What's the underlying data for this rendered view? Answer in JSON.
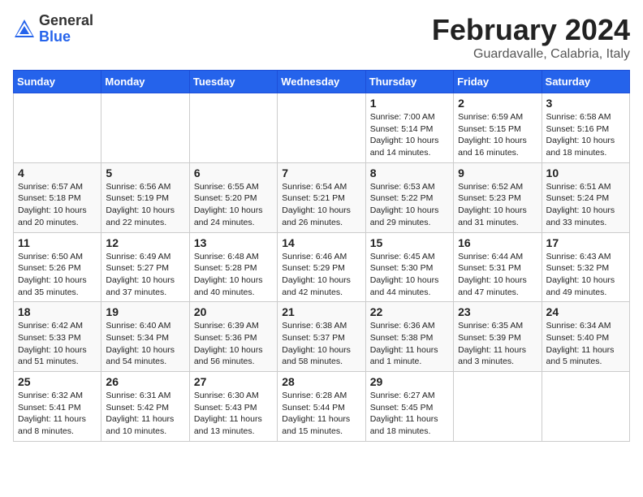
{
  "header": {
    "logo_general": "General",
    "logo_blue": "Blue",
    "month_title": "February 2024",
    "location": "Guardavalle, Calabria, Italy"
  },
  "days_of_week": [
    "Sunday",
    "Monday",
    "Tuesday",
    "Wednesday",
    "Thursday",
    "Friday",
    "Saturday"
  ],
  "weeks": [
    [
      {
        "day": "",
        "detail": ""
      },
      {
        "day": "",
        "detail": ""
      },
      {
        "day": "",
        "detail": ""
      },
      {
        "day": "",
        "detail": ""
      },
      {
        "day": "1",
        "detail": "Sunrise: 7:00 AM\nSunset: 5:14 PM\nDaylight: 10 hours\nand 14 minutes."
      },
      {
        "day": "2",
        "detail": "Sunrise: 6:59 AM\nSunset: 5:15 PM\nDaylight: 10 hours\nand 16 minutes."
      },
      {
        "day": "3",
        "detail": "Sunrise: 6:58 AM\nSunset: 5:16 PM\nDaylight: 10 hours\nand 18 minutes."
      }
    ],
    [
      {
        "day": "4",
        "detail": "Sunrise: 6:57 AM\nSunset: 5:18 PM\nDaylight: 10 hours\nand 20 minutes."
      },
      {
        "day": "5",
        "detail": "Sunrise: 6:56 AM\nSunset: 5:19 PM\nDaylight: 10 hours\nand 22 minutes."
      },
      {
        "day": "6",
        "detail": "Sunrise: 6:55 AM\nSunset: 5:20 PM\nDaylight: 10 hours\nand 24 minutes."
      },
      {
        "day": "7",
        "detail": "Sunrise: 6:54 AM\nSunset: 5:21 PM\nDaylight: 10 hours\nand 26 minutes."
      },
      {
        "day": "8",
        "detail": "Sunrise: 6:53 AM\nSunset: 5:22 PM\nDaylight: 10 hours\nand 29 minutes."
      },
      {
        "day": "9",
        "detail": "Sunrise: 6:52 AM\nSunset: 5:23 PM\nDaylight: 10 hours\nand 31 minutes."
      },
      {
        "day": "10",
        "detail": "Sunrise: 6:51 AM\nSunset: 5:24 PM\nDaylight: 10 hours\nand 33 minutes."
      }
    ],
    [
      {
        "day": "11",
        "detail": "Sunrise: 6:50 AM\nSunset: 5:26 PM\nDaylight: 10 hours\nand 35 minutes."
      },
      {
        "day": "12",
        "detail": "Sunrise: 6:49 AM\nSunset: 5:27 PM\nDaylight: 10 hours\nand 37 minutes."
      },
      {
        "day": "13",
        "detail": "Sunrise: 6:48 AM\nSunset: 5:28 PM\nDaylight: 10 hours\nand 40 minutes."
      },
      {
        "day": "14",
        "detail": "Sunrise: 6:46 AM\nSunset: 5:29 PM\nDaylight: 10 hours\nand 42 minutes."
      },
      {
        "day": "15",
        "detail": "Sunrise: 6:45 AM\nSunset: 5:30 PM\nDaylight: 10 hours\nand 44 minutes."
      },
      {
        "day": "16",
        "detail": "Sunrise: 6:44 AM\nSunset: 5:31 PM\nDaylight: 10 hours\nand 47 minutes."
      },
      {
        "day": "17",
        "detail": "Sunrise: 6:43 AM\nSunset: 5:32 PM\nDaylight: 10 hours\nand 49 minutes."
      }
    ],
    [
      {
        "day": "18",
        "detail": "Sunrise: 6:42 AM\nSunset: 5:33 PM\nDaylight: 10 hours\nand 51 minutes."
      },
      {
        "day": "19",
        "detail": "Sunrise: 6:40 AM\nSunset: 5:34 PM\nDaylight: 10 hours\nand 54 minutes."
      },
      {
        "day": "20",
        "detail": "Sunrise: 6:39 AM\nSunset: 5:36 PM\nDaylight: 10 hours\nand 56 minutes."
      },
      {
        "day": "21",
        "detail": "Sunrise: 6:38 AM\nSunset: 5:37 PM\nDaylight: 10 hours\nand 58 minutes."
      },
      {
        "day": "22",
        "detail": "Sunrise: 6:36 AM\nSunset: 5:38 PM\nDaylight: 11 hours\nand 1 minute."
      },
      {
        "day": "23",
        "detail": "Sunrise: 6:35 AM\nSunset: 5:39 PM\nDaylight: 11 hours\nand 3 minutes."
      },
      {
        "day": "24",
        "detail": "Sunrise: 6:34 AM\nSunset: 5:40 PM\nDaylight: 11 hours\nand 5 minutes."
      }
    ],
    [
      {
        "day": "25",
        "detail": "Sunrise: 6:32 AM\nSunset: 5:41 PM\nDaylight: 11 hours\nand 8 minutes."
      },
      {
        "day": "26",
        "detail": "Sunrise: 6:31 AM\nSunset: 5:42 PM\nDaylight: 11 hours\nand 10 minutes."
      },
      {
        "day": "27",
        "detail": "Sunrise: 6:30 AM\nSunset: 5:43 PM\nDaylight: 11 hours\nand 13 minutes."
      },
      {
        "day": "28",
        "detail": "Sunrise: 6:28 AM\nSunset: 5:44 PM\nDaylight: 11 hours\nand 15 minutes."
      },
      {
        "day": "29",
        "detail": "Sunrise: 6:27 AM\nSunset: 5:45 PM\nDaylight: 11 hours\nand 18 minutes."
      },
      {
        "day": "",
        "detail": ""
      },
      {
        "day": "",
        "detail": ""
      }
    ]
  ]
}
